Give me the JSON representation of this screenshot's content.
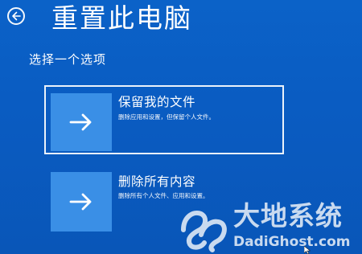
{
  "header": {
    "back_icon": "back-arrow-circle-icon",
    "title": "重置此电脑"
  },
  "main": {
    "subtitle": "选择一个选项",
    "options": [
      {
        "label": "保留我的文件",
        "description": "删除应用和设置，但保留个人文件。",
        "icon": "right-arrow-icon",
        "selected": true
      },
      {
        "label": "删除所有内容",
        "description": "删除所有个人文件、应用和设置。",
        "icon": "right-arrow-icon",
        "selected": false
      }
    ]
  },
  "watermark": {
    "cn": "大地系统",
    "en": "DadiGhost.com"
  },
  "colors": {
    "background": "#0a5cc2",
    "tile": "#3a8fe6",
    "text": "#ffffff"
  }
}
